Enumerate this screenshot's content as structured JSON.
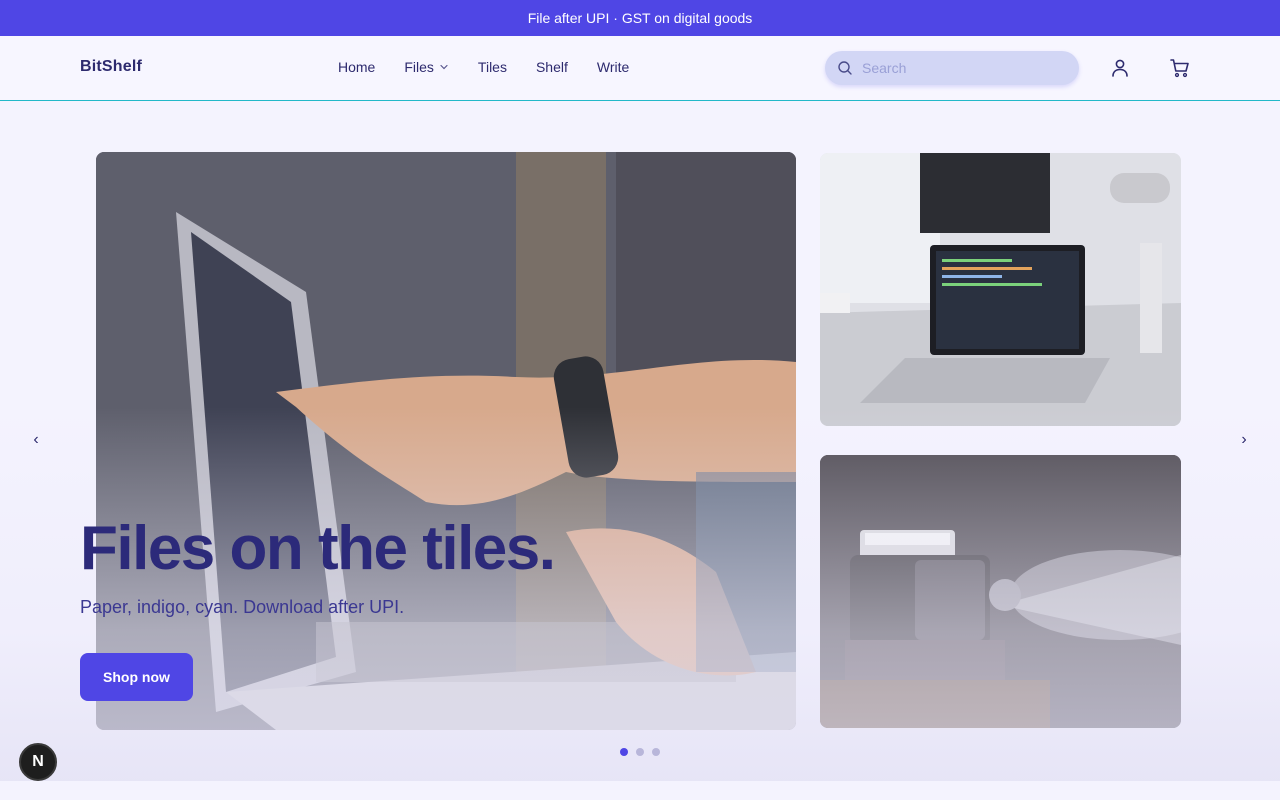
{
  "announcement": {
    "text": "File after UPI · GST on digital goods"
  },
  "header": {
    "logo": "BitShelf",
    "nav": [
      {
        "label": "Home"
      },
      {
        "label": "Files",
        "has_dropdown": true
      },
      {
        "label": "Tiles"
      },
      {
        "label": "Shelf"
      },
      {
        "label": "Write"
      }
    ],
    "search": {
      "placeholder": "Search",
      "value": ""
    },
    "icons": [
      "search-icon",
      "user-icon",
      "cart-icon",
      "chevron-down-icon"
    ]
  },
  "hero": {
    "headline": "Files on the tiles.",
    "subline": "Paper, indigo, cyan. Download after UPI.",
    "cta_label": "Shop now",
    "prev_label": "‹",
    "next_label": "›",
    "slides_count": 3,
    "active_slide": 1,
    "images": [
      "laptop-hand-photo",
      "laptop-desk-photo",
      "projector-photo"
    ]
  },
  "badge": {
    "label": "N"
  },
  "colors": {
    "accent": "#4f46e5",
    "header_border": "#22b8c8",
    "background": "#f4f3fe",
    "headline": "#2c2a7a"
  }
}
